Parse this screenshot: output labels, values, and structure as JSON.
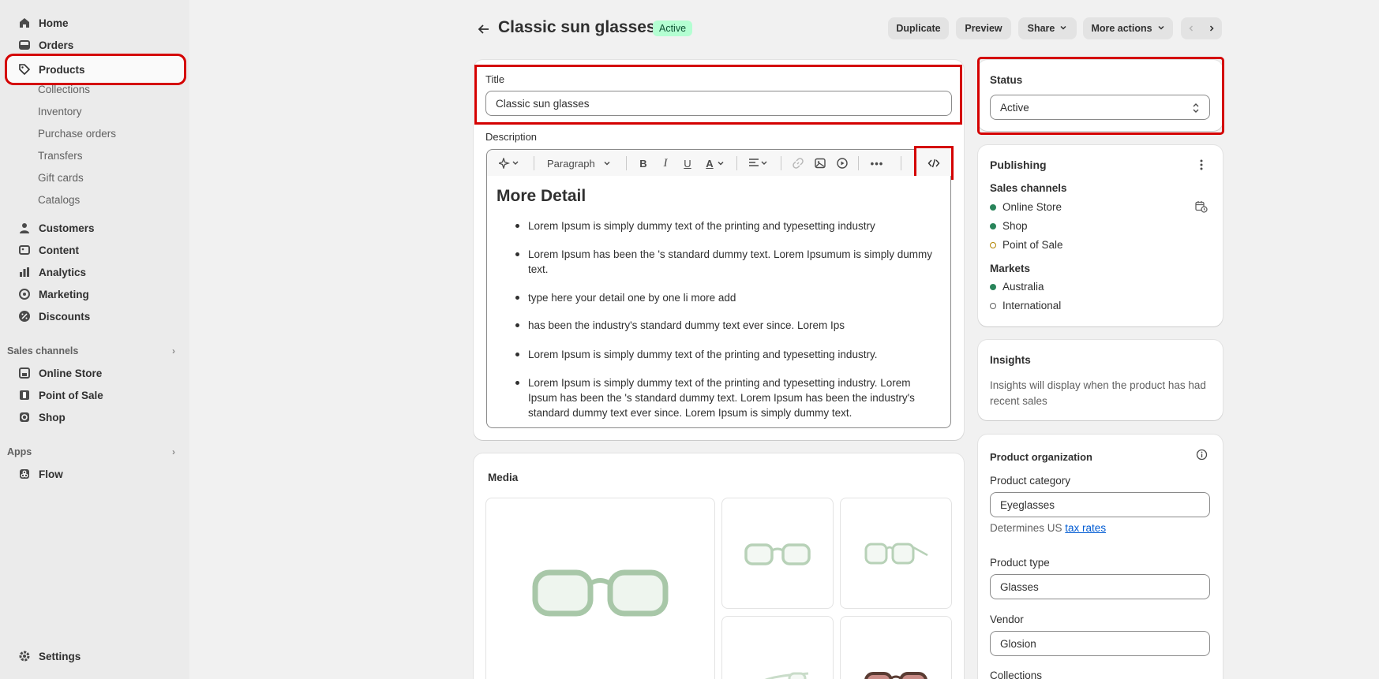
{
  "sidebar": {
    "home": "Home",
    "orders": "Orders",
    "products": "Products",
    "collections": "Collections",
    "inventory": "Inventory",
    "purchase_orders": "Purchase orders",
    "transfers": "Transfers",
    "gift_cards": "Gift cards",
    "catalogs": "Catalogs",
    "customers": "Customers",
    "content": "Content",
    "analytics": "Analytics",
    "marketing": "Marketing",
    "discounts": "Discounts",
    "sales_channels_header": "Sales channels",
    "online_store": "Online Store",
    "point_of_sale": "Point of Sale",
    "shop": "Shop",
    "apps_header": "Apps",
    "flow": "Flow",
    "settings": "Settings"
  },
  "header": {
    "title": "Classic sun glasses",
    "status_badge": "Active",
    "duplicate": "Duplicate",
    "preview": "Preview",
    "share": "Share",
    "more_actions": "More actions"
  },
  "product": {
    "title_label": "Title",
    "title_value": "Classic sun glasses",
    "description_label": "Description",
    "toolbar_paragraph": "Paragraph",
    "heading": "More Detail",
    "bullets": [
      "Lorem Ipsum is simply dummy text of the printing and typesetting industry",
      "Lorem Ipsum has been the 's standard dummy text. Lorem Ipsumum is simply dummy text.",
      "type here your detail one by one li more add",
      "has been the industry's standard dummy text ever since. Lorem Ips",
      "Lorem Ipsum is simply dummy text of the printing and typesetting industry.",
      "Lorem Ipsum is simply dummy text of the printing and typesetting industry. Lorem Ipsum has been the 's standard dummy text. Lorem Ipsum has been the industry's standard dummy text ever since. Lorem Ipsum is simply dummy text."
    ]
  },
  "media": {
    "title": "Media"
  },
  "status_card": {
    "label": "Status",
    "value": "Active"
  },
  "publishing": {
    "title": "Publishing",
    "sales_channels_label": "Sales channels",
    "channels": [
      "Online Store",
      "Shop",
      "Point of Sale"
    ],
    "markets_label": "Markets",
    "markets": [
      "Australia",
      "International"
    ]
  },
  "insights": {
    "title": "Insights",
    "text": "Insights will display when the product has had recent sales"
  },
  "organization": {
    "title": "Product organization",
    "category_label": "Product category",
    "category_value": "Eyeglasses",
    "tax_prefix": "Determines US",
    "tax_link": "tax rates",
    "type_label": "Product type",
    "type_value": "Glasses",
    "vendor_label": "Vendor",
    "vendor_value": "Glosion",
    "collections_label": "Collections"
  },
  "colors": {
    "highlight": "#d40000",
    "active_badge_bg": "#b4fed2",
    "channel_dot": "#29845a"
  }
}
